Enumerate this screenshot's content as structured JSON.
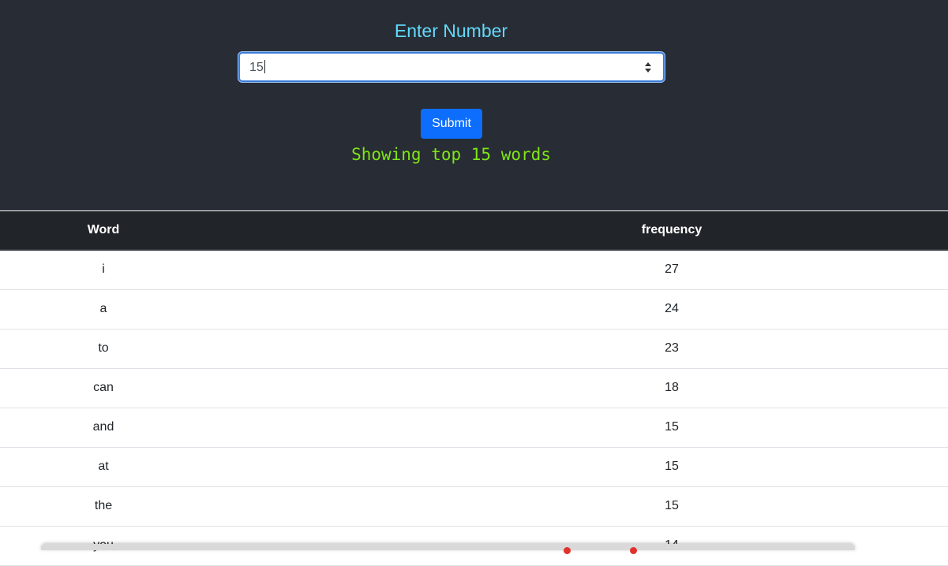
{
  "header": {
    "title": "Enter Number",
    "input_value": "15",
    "submit_label": "Submit",
    "showing_text": "Showing top 15 words"
  },
  "table": {
    "columns": [
      "Word",
      "frequency"
    ],
    "rows": [
      {
        "word": "i",
        "frequency": "27"
      },
      {
        "word": "a",
        "frequency": "24"
      },
      {
        "word": "to",
        "frequency": "23"
      },
      {
        "word": "can",
        "frequency": "18"
      },
      {
        "word": "and",
        "frequency": "15"
      },
      {
        "word": "at",
        "frequency": "15"
      },
      {
        "word": "the",
        "frequency": "15"
      },
      {
        "word": "you",
        "frequency": "14"
      }
    ]
  },
  "colors": {
    "header_bg": "#282c34",
    "title": "#61dafb",
    "button": "#0d6efd",
    "showing": "#7fe616",
    "table_head_bg": "#212529"
  },
  "icons": {
    "spinner": "number-spinner-arrows"
  }
}
